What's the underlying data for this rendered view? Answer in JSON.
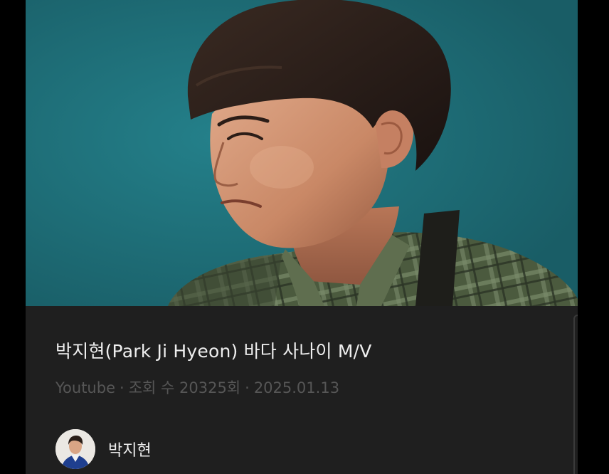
{
  "video": {
    "thumbnail_alt": "박지현(Park Ji Hyeon) 바다 사나이 M/V",
    "title": "박지현(Park Ji Hyeon) 바다 사나이 M/V",
    "source": "Youtube",
    "separator": "·",
    "views": "조회 수 20325회",
    "date": "2025.01.13"
  },
  "channel": {
    "name": "박지현"
  },
  "colors": {
    "background": "#000000",
    "card": "#1f1f1f",
    "thumbnail_teal": "#1c6a74",
    "title_text": "#eeeeee",
    "meta_text": "#565656"
  }
}
